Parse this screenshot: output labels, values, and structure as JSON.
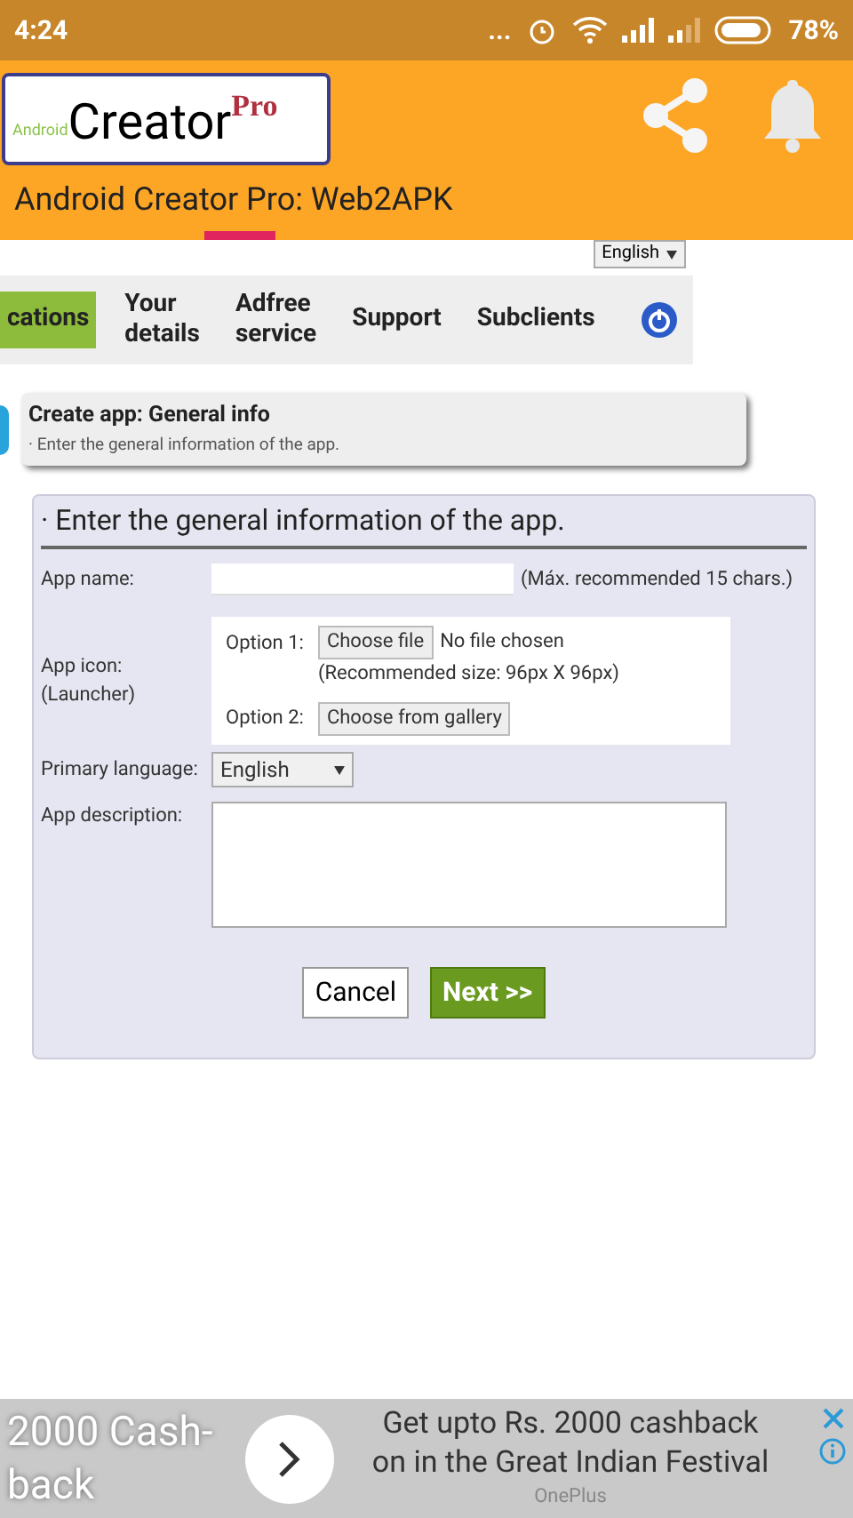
{
  "status_bar": {
    "time": "4:24",
    "dots": "...",
    "battery": "78%"
  },
  "header": {
    "logo": {
      "small": "Android",
      "main": "Creator",
      "sup": "Pro"
    },
    "title": "Android Creator Pro: Web2APK"
  },
  "language_select": {
    "value": "English"
  },
  "nav": [
    {
      "label": "cations",
      "selected": true
    },
    {
      "label": "Your details",
      "selected": false
    },
    {
      "label": "Adfree service",
      "selected": false
    },
    {
      "label": "Support",
      "selected": false
    },
    {
      "label": "Subclients",
      "selected": false
    }
  ],
  "step": {
    "title": "Create app: General info",
    "subtitle": "· Enter the general information of the app."
  },
  "form": {
    "heading": "· Enter the general information of the app.",
    "app_name": {
      "label": "App name:",
      "hint": "(Máx. recommended 15 chars.)"
    },
    "app_icon": {
      "label": "App icon: (Launcher)",
      "option1": "Option 1:",
      "choose_file": "Choose file",
      "no_file": "No file chosen",
      "size_hint": "(Recommended size: 96px X 96px)",
      "option2": "Option 2:",
      "gallery": "Choose from gallery"
    },
    "language": {
      "label": "Primary language:",
      "value": "English"
    },
    "description": {
      "label": "App description:"
    },
    "buttons": [
      {
        "label": "Cancel",
        "kind": "plain"
      },
      {
        "label": "Next >>",
        "kind": "primary"
      }
    ]
  },
  "ad": {
    "left": "2000 Cash- back",
    "line1": "Get upto Rs. 2000 cashback",
    "line2": "on in the Great Indian Festival",
    "brand": "OnePlus"
  }
}
